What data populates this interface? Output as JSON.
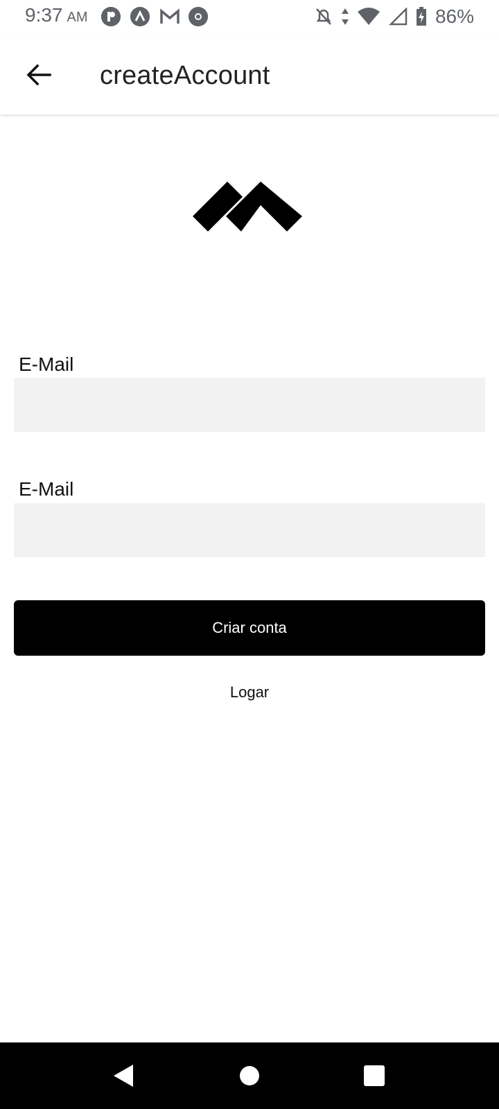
{
  "status_bar": {
    "time": "9:37",
    "ampm": "AM",
    "battery": "86%",
    "notification_icons": [
      "app-icon-r",
      "app-icon-a",
      "gmail-icon",
      "chrome-icon"
    ]
  },
  "app_bar": {
    "title": "createAccount",
    "back_icon": "arrow-left-icon"
  },
  "logo": {
    "icon": "brand-logo"
  },
  "form": {
    "field1_label": "E-Mail",
    "field1_value": "",
    "field2_label": "E-Mail",
    "field2_value": "",
    "submit_label": "Criar conta",
    "login_link_label": "Logar"
  },
  "colors": {
    "primary": "#000000",
    "input_bg": "#f2f2f2",
    "status_text": "#5f6368"
  },
  "nav_bar": {
    "buttons": [
      "back-icon",
      "home-icon",
      "recents-icon"
    ]
  }
}
